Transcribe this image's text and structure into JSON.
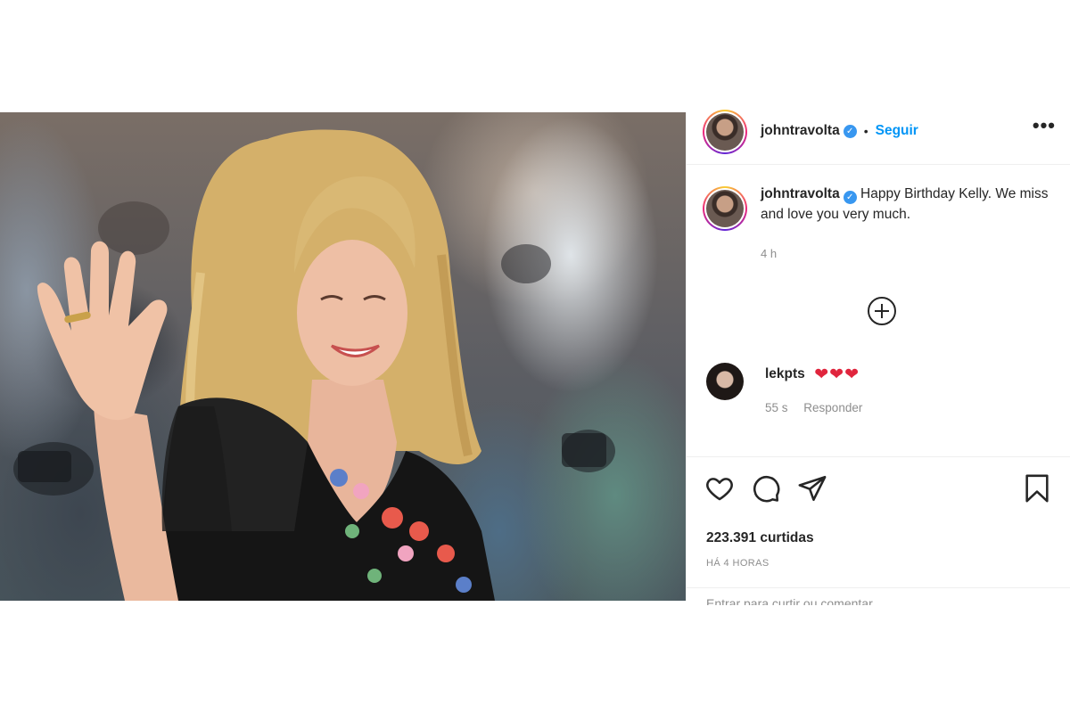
{
  "post": {
    "author": "johntravolta",
    "follow_label": "Seguir",
    "separator": "•",
    "more_label": "•••",
    "verified_mark": "✓"
  },
  "caption": {
    "author": "johntravolta",
    "text": "Happy Birthday Kelly. We miss and love you very much.",
    "time": "4 h"
  },
  "comments": [
    {
      "author": "lekpts",
      "hearts": "❤❤❤",
      "time": "55 s",
      "reply_label": "Responder"
    }
  ],
  "actions": {
    "icons": [
      "heart-icon",
      "comment-icon",
      "share-icon",
      "bookmark-icon"
    ],
    "likes": "223.391 curtidas",
    "posted_ago": "HÁ 4 HORAS",
    "add_comment_placeholder": "Entrar para curtir ou comentar."
  },
  "colors": {
    "accent": "#0095f6",
    "verified": "#3897f0",
    "heart": "#e0253d",
    "muted_text": "#8e8e8e",
    "text": "#262626"
  }
}
